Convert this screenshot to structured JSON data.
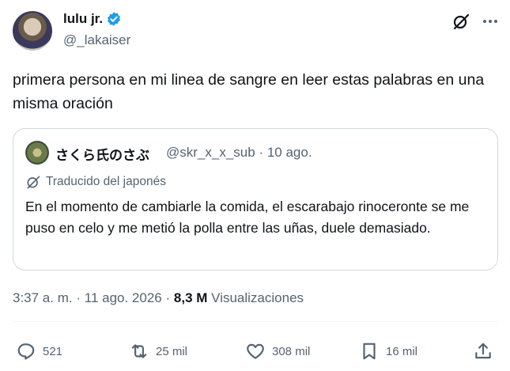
{
  "author": {
    "name": "lulu jr.",
    "handle": "@_lakaiser",
    "verified": true
  },
  "post_text": "primera persona en mi linea de sangre en leer estas palabras en una misma oración",
  "quoted": {
    "name": "さくら氏のさぶ",
    "handle": "@skr_x_x_sub",
    "separator": "·",
    "date": "10 ago.",
    "translation_label": "Traducido del japonés",
    "text": "En el momento de cambiarle la comida, el escarabajo rinoceronte se me puso en celo y me metió la polla entre las uñas, duele demasiado."
  },
  "meta": {
    "time": "3:37 a. m.",
    "sep1": "·",
    "date": "11 ago. 2026",
    "sep2": "·",
    "views_count": "8,3 M",
    "views_label": "Visualizaciones"
  },
  "actions": {
    "replies": "521",
    "reposts": "25 mil",
    "likes": "308 mil",
    "bookmarks": "16 mil"
  },
  "colors": {
    "accent": "#1d9bf0",
    "secondary_text": "#536471",
    "border": "#cfd9de"
  }
}
